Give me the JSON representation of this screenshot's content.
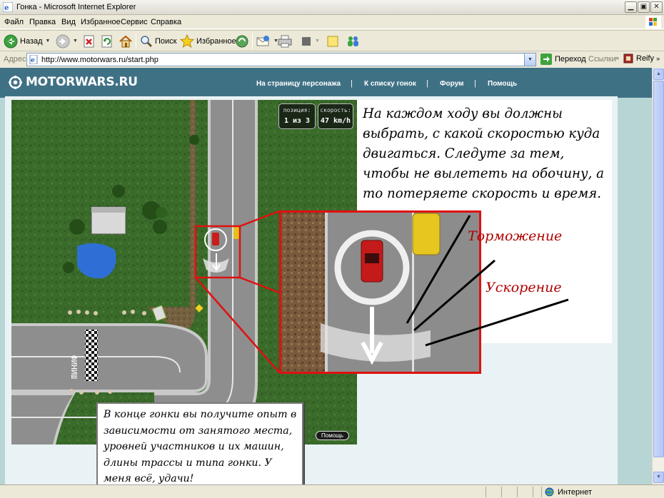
{
  "window": {
    "title": "Гонка - Microsoft Internet Explorer"
  },
  "menu": {
    "items": [
      "Файл",
      "Правка",
      "Вид",
      "Избранное",
      "Сервис",
      "Справка"
    ]
  },
  "toolbar": {
    "back_label": "Назад",
    "search_label": "Поиск",
    "favorites_label": "Избранное"
  },
  "address": {
    "label": "Адрес:",
    "url": "http://www.motorwars.ru/start.php",
    "go_label": "Переход",
    "links_label": "Ссылки",
    "extension_label": "Reify"
  },
  "site": {
    "logo": "MOTORWARS.RU",
    "nav": [
      "На страницу персонажа",
      "К списку гонок",
      "Форум",
      "Помощь"
    ],
    "separator": "|"
  },
  "game": {
    "position_label": "позиция:",
    "position_value": "1 из 3",
    "speed_label": "скорость:",
    "speed_value": "47 km/h",
    "finish_label": "ФИНИШ",
    "help_button": "Помощь"
  },
  "annotations": {
    "top_text": "На каждом ходу вы должны выбрать, с какой скоростью куда двигаться. Следуте за тем, чтобы не вылететь на обочину, а то потеряете скорость и время.",
    "braking_label": "Торможение",
    "accel_label": "Ускорение",
    "bottom_text": "В конце гонки вы получите опыт в зависимости от занятого места, уровней участников и их машин, длины трассы и типа гонки. У меня всё, удачи!"
  },
  "statusbar": {
    "zone": "Интернет"
  },
  "colors": {
    "site_header": "#3f7185",
    "page_bg": "#b8d5d5",
    "grass": "#3a6b2a",
    "road": "#8e8e8e",
    "highlight": "#e01010",
    "annotation_text": "#b00000"
  },
  "icons": [
    "ie-icon",
    "minimize-icon",
    "maximize-icon",
    "close-icon",
    "windows-logo-icon",
    "back-icon",
    "forward-icon",
    "stop-icon",
    "refresh-icon",
    "home-icon",
    "search-icon",
    "favorites-star-icon",
    "media-icon",
    "mail-icon",
    "print-icon",
    "edit-icon",
    "notes-icon",
    "messenger-icon",
    "page-icon",
    "go-arrow-icon",
    "reify-icon",
    "globe-icon"
  ]
}
